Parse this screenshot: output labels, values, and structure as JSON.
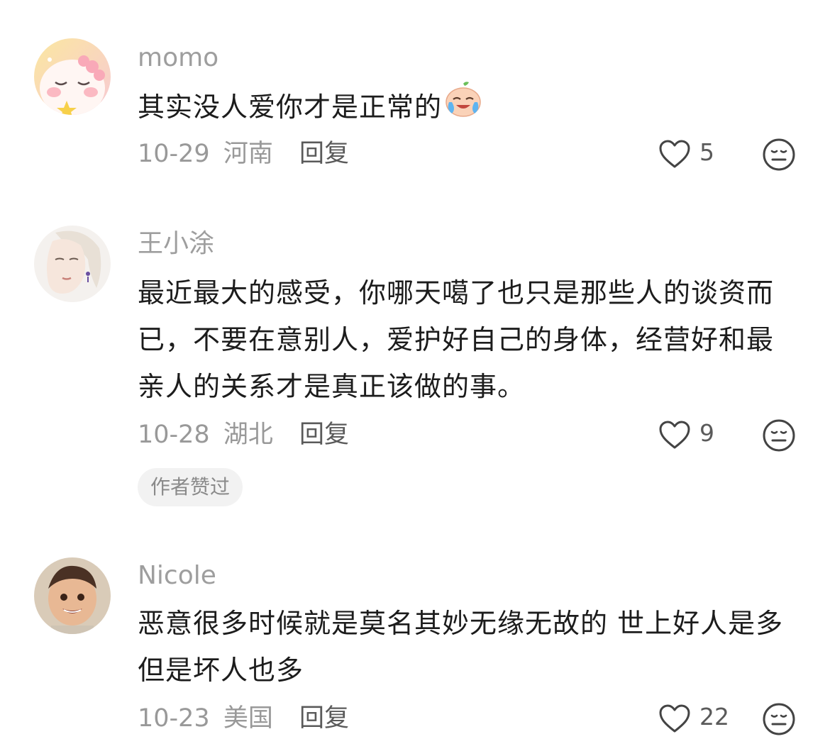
{
  "comments": [
    {
      "username": "momo",
      "avatar": "cartoon-star-character-avatar",
      "text": "其实没人爱你才是正常的",
      "emoji": "crying-laughing-peach-emoji",
      "date": "10-29",
      "location": "河南",
      "reply_label": "回复",
      "likes": "5"
    },
    {
      "username": "王小涂",
      "avatar": "woman-portrait-avatar",
      "text": "最近最大的感受，你哪天噶了也只是那些人的谈资而已，不要在意别人，爱护好自己的身体，经营好和最亲人的关系才是真正该做的事。",
      "date": "10-28",
      "location": "湖北",
      "reply_label": "回复",
      "likes": "9",
      "badge": "作者赞过"
    },
    {
      "username": "Nicole",
      "avatar": "smiling-child-photo-avatar",
      "text": "恶意很多时候就是莫名其妙无缘无故的 世上好人是多但是坏人也多",
      "date": "10-23",
      "location": "美国",
      "reply_label": "回复",
      "likes": "22"
    }
  ],
  "icons": {
    "like": "heart-outline-icon",
    "dislike": "meh-face-icon"
  },
  "colors": {
    "username": "#9e9e9e",
    "meta": "#999999",
    "text": "#1c1c1c",
    "badge_bg": "#f2f2f2"
  }
}
